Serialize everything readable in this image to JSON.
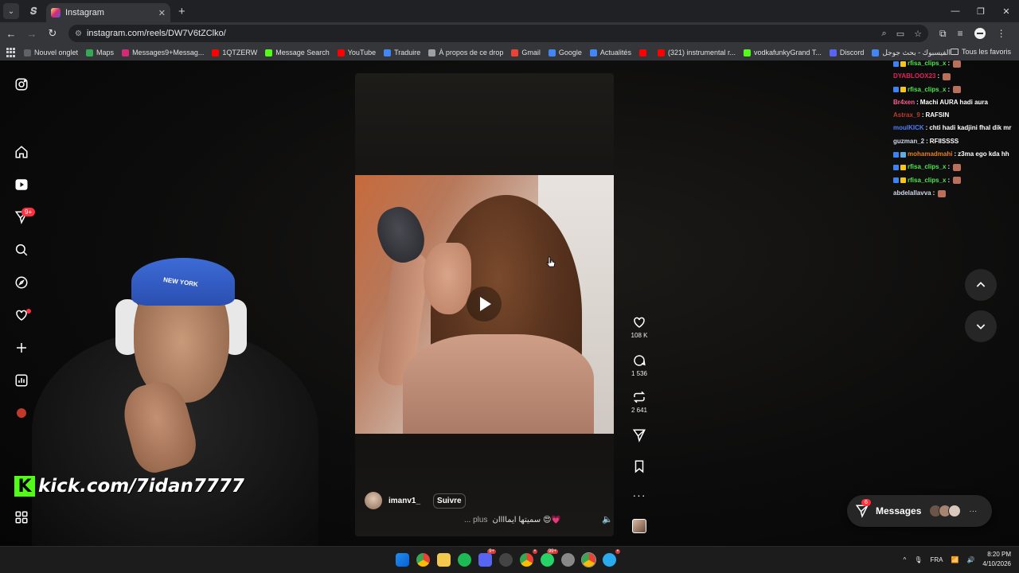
{
  "browser": {
    "tab_title": "Instagram",
    "url": "instagram.com/reels/DW7V6tZClko/",
    "bookmarks": [
      {
        "label": "Nouvel onglet",
        "color": "#5f6368"
      },
      {
        "label": "Maps",
        "color": "#34a853"
      },
      {
        "label": "Messages9+Messag...",
        "color": "#d62976"
      },
      {
        "label": "1QTZERW",
        "color": "#ff0000"
      },
      {
        "label": "Message Search",
        "color": "#53fc18"
      },
      {
        "label": "YouTube",
        "color": "#ff0000"
      },
      {
        "label": "Traduire",
        "color": "#4285f4"
      },
      {
        "label": "À propos de ce drop",
        "color": "#9aa0a6"
      },
      {
        "label": "Gmail",
        "color": "#ea4335"
      },
      {
        "label": "Google",
        "color": "#4285f4"
      },
      {
        "label": "Actualités",
        "color": "#4285f4"
      },
      {
        "label": "",
        "color": "#ff0000"
      },
      {
        "label": "(321) instrumental r...",
        "color": "#ff0000"
      },
      {
        "label": "vodkafunkyGrand T...",
        "color": "#53fc18"
      },
      {
        "label": "Discord",
        "color": "#5865f2"
      },
      {
        "label": "الفيسبوك - بحث جوجل",
        "color": "#4285f4"
      }
    ],
    "all_bookmarks_label": "Tous les favoris"
  },
  "nav": {
    "notification_badge": "9+"
  },
  "stream": {
    "banner_text": "kick.com/7idan7777",
    "cap_text": "NEW YORK"
  },
  "reel": {
    "author": "imanv1_",
    "follow_label": "Suivre",
    "caption": "سميتها ايماااان 😍💗",
    "more_label": "... plus",
    "likes": "108 K",
    "comments": "1 536",
    "reposts": "2 641"
  },
  "chat": [
    {
      "user": "rfisa_clips_x",
      "color": "#4fe64f",
      "msg": "",
      "emote": true,
      "badges": [
        "#3b82f6",
        "#f5c518"
      ]
    },
    {
      "user": "DYABLOOX23",
      "color": "#e0245e",
      "msg": "",
      "emote": true,
      "badges": []
    },
    {
      "user": "rfisa_clips_x",
      "color": "#4fe64f",
      "msg": "",
      "emote": true,
      "badges": [
        "#3b82f6",
        "#f5c518"
      ]
    },
    {
      "user": "Br4xen",
      "color": "#ff5a8a",
      "msg": "Machi AURA hadi aura",
      "emote": false,
      "badges": []
    },
    {
      "user": "Astrax_9",
      "color": "#c0392b",
      "msg": "RAFSIN",
      "emote": false,
      "badges": []
    },
    {
      "user": "moulKICK",
      "color": "#4f7dff",
      "msg": "chti hadi kadjini fhal dik mr",
      "emote": false,
      "badges": []
    },
    {
      "user": "guzman_2",
      "color": "#cfd8e8",
      "msg": "RFIISSSS",
      "emote": false,
      "badges": []
    },
    {
      "user": "mohamadmahi",
      "color": "#e67e22",
      "msg": "z3ma ego kda hh",
      "emote": false,
      "badges": [
        "#3b82f6",
        "#5dade2"
      ]
    },
    {
      "user": "rfisa_clips_x",
      "color": "#4fe64f",
      "msg": "",
      "emote": true,
      "badges": [
        "#3b82f6",
        "#f5c518"
      ]
    },
    {
      "user": "rfisa_clips_x",
      "color": "#4fe64f",
      "msg": "",
      "emote": true,
      "badges": [
        "#3b82f6",
        "#f5c518"
      ]
    },
    {
      "user": "abdelallavva",
      "color": "#cfd8e8",
      "msg": "",
      "emote": true,
      "badges": []
    }
  ],
  "messages": {
    "label": "Messages",
    "badge": "6"
  },
  "taskbar": {
    "lang": "FRA",
    "time": "8:20 PM",
    "date": "4/10/2026"
  }
}
